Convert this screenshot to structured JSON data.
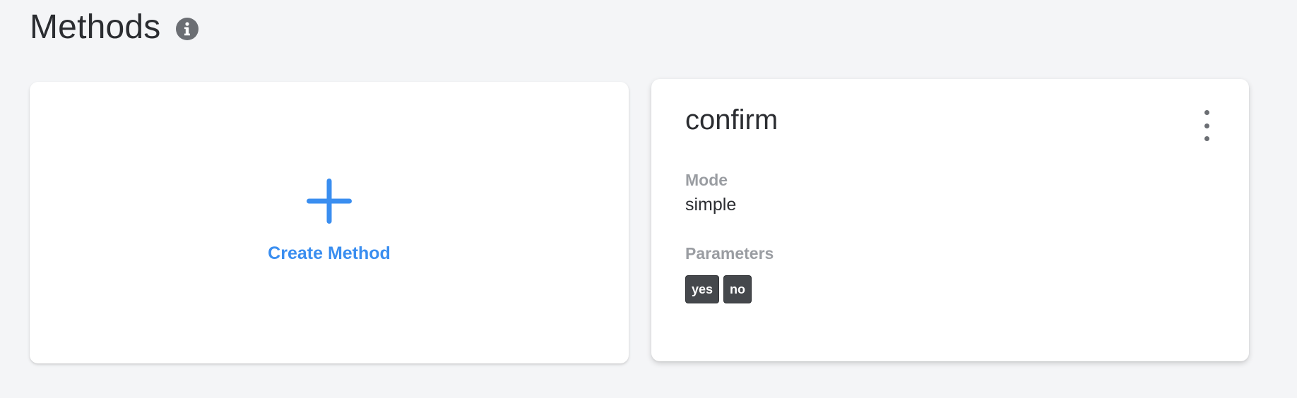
{
  "header": {
    "title": "Methods",
    "info_icon": "info-icon"
  },
  "create_card": {
    "icon": "plus-icon",
    "label": "Create Method",
    "accent_color": "#3a8ef0"
  },
  "methods": [
    {
      "name": "confirm",
      "menu_icon": "kebab-menu-icon",
      "mode_label": "Mode",
      "mode_value": "simple",
      "parameters_label": "Parameters",
      "parameters": [
        "yes",
        "no"
      ]
    }
  ]
}
